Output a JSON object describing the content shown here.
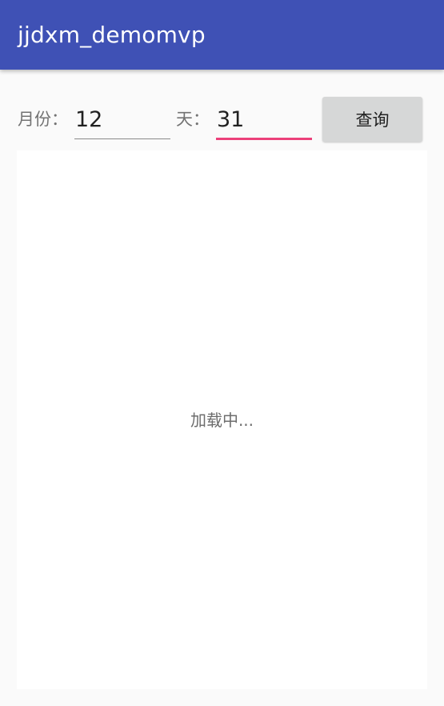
{
  "toolbar": {
    "title": "jjdxm_demomvp",
    "color": "#3f51b5"
  },
  "query_form": {
    "month_label": "月份：",
    "month_value": "12",
    "day_label": "天：",
    "day_value": "31",
    "query_button_label": "查询",
    "focused_field": "day",
    "focus_color": "#ec407a"
  },
  "content": {
    "loading_text": "加载中..."
  }
}
